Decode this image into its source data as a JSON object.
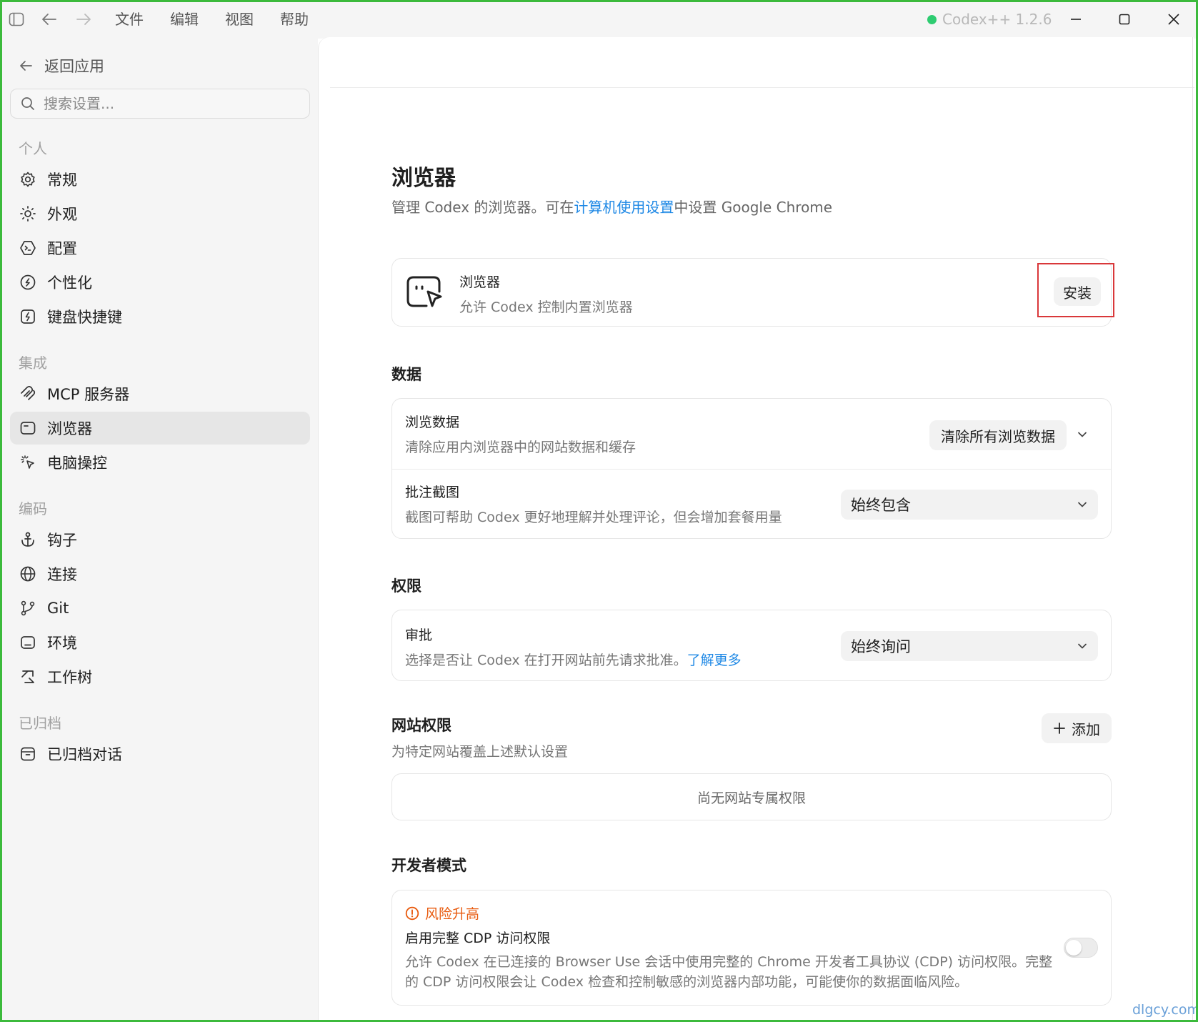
{
  "titlebar": {
    "menus": [
      "文件",
      "编辑",
      "视图",
      "帮助"
    ],
    "app_title": "Codex++ 1.2.6",
    "status_color": "#2ecc71"
  },
  "sidebar": {
    "back_label": "返回应用",
    "search_placeholder": "搜索设置...",
    "sections": {
      "personal": "个人",
      "integration": "集成",
      "coding": "编码",
      "archived": "已归档"
    },
    "items": {
      "general": "常规",
      "appearance": "外观",
      "config": "配置",
      "personalize": "个性化",
      "shortcuts": "键盘快捷键",
      "mcp": "MCP 服务器",
      "browser": "浏览器",
      "computer": "电脑操控",
      "hooks": "钩子",
      "connections": "连接",
      "git": "Git",
      "environment": "环境",
      "worktree": "工作树",
      "archived_chats": "已归档对话"
    },
    "active_item": "browser"
  },
  "main": {
    "title": "浏览器",
    "desc_prefix": "管理 Codex 的浏览器。可在",
    "desc_link": "计算机使用设置",
    "desc_suffix": "中设置 Google Chrome",
    "plugin": {
      "title": "浏览器",
      "desc": "允许 Codex 控制内置浏览器",
      "install_label": "安装",
      "highlight_color": "#d9383a"
    },
    "data_section": {
      "heading": "数据",
      "browsing": {
        "title": "浏览数据",
        "desc": "清除应用内浏览器中的网站数据和缓存",
        "button": "清除所有浏览数据"
      },
      "screenshot": {
        "title": "批注截图",
        "desc": "截图可帮助 Codex 更好地理解并处理评论，但会增加套餐用量",
        "selected": "始终包含"
      }
    },
    "permissions": {
      "heading": "权限",
      "approval": {
        "title": "审批",
        "desc": "选择是否让 Codex 在打开网站前先请求批准。",
        "link": "了解更多",
        "selected": "始终询问"
      }
    },
    "site_permissions": {
      "heading": "网站权限",
      "desc": "为特定网站覆盖上述默认设置",
      "add_label": "添加",
      "empty": "尚无网站专属权限"
    },
    "developer": {
      "heading": "开发者模式",
      "risk_label": "风险升高",
      "risk_color": "#e8590c",
      "cdp_title": "启用完整 CDP 访问权限",
      "cdp_desc_line1": "允许 Codex 在已连接的 Browser Use 会话中使用完整的 Chrome 开发者工具协议 (CDP) 访问权限。完整",
      "cdp_desc_line2": "的 CDP 访问权限会让 Codex 检查和控制敏感的浏览器内部功能，可能使你的数据面临风险。",
      "cdp_enabled": false
    }
  },
  "watermark": "dlgcy.com"
}
